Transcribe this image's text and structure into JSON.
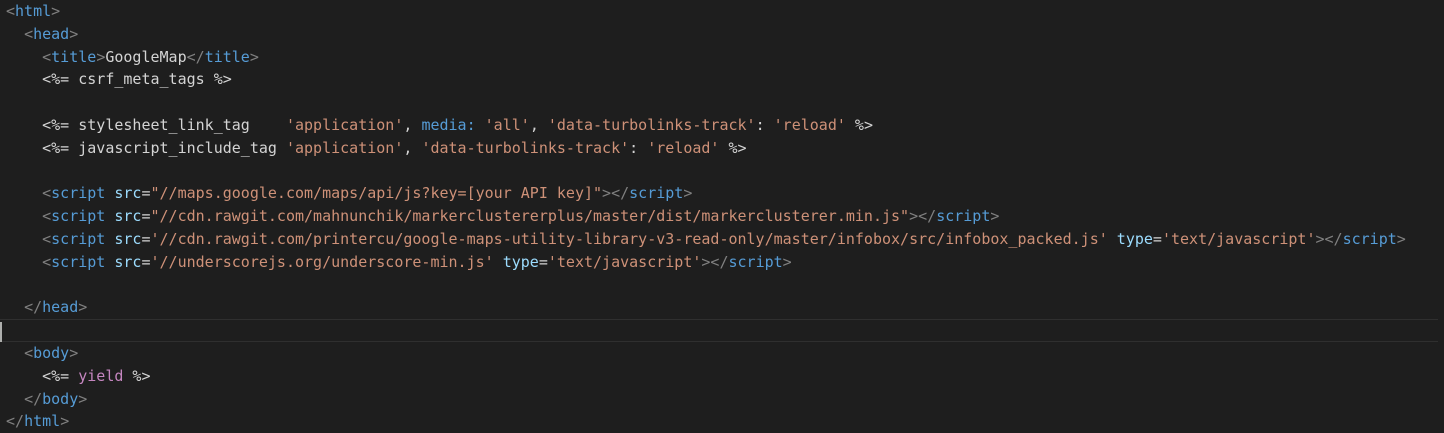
{
  "editor": {
    "lines": [
      {
        "indent": "",
        "tokens": [
          {
            "t": "<",
            "c": "c-punct"
          },
          {
            "t": "html",
            "c": "c-tag"
          },
          {
            "t": ">",
            "c": "c-punct"
          }
        ]
      },
      {
        "indent": "  ",
        "tokens": [
          {
            "t": "<",
            "c": "c-punct"
          },
          {
            "t": "head",
            "c": "c-tag"
          },
          {
            "t": ">",
            "c": "c-punct"
          }
        ]
      },
      {
        "indent": "    ",
        "tokens": [
          {
            "t": "<",
            "c": "c-punct"
          },
          {
            "t": "title",
            "c": "c-tag"
          },
          {
            "t": ">",
            "c": "c-punct"
          },
          {
            "t": "GoogleMap",
            "c": "c-text"
          },
          {
            "t": "</",
            "c": "c-punct"
          },
          {
            "t": "title",
            "c": "c-tag"
          },
          {
            "t": ">",
            "c": "c-punct"
          }
        ]
      },
      {
        "indent": "    ",
        "tokens": [
          {
            "t": "<%= csrf_meta_tags %>",
            "c": "c-erb"
          }
        ]
      },
      {
        "indent": "",
        "tokens": []
      },
      {
        "indent": "    ",
        "tokens": [
          {
            "t": "<%= stylesheet_link_tag    ",
            "c": "c-erb"
          },
          {
            "t": "'application'",
            "c": "c-str"
          },
          {
            "t": ", ",
            "c": "c-erb"
          },
          {
            "t": "media:",
            "c": "c-tag"
          },
          {
            "t": " ",
            "c": "c-erb"
          },
          {
            "t": "'all'",
            "c": "c-str"
          },
          {
            "t": ", ",
            "c": "c-erb"
          },
          {
            "t": "'data-turbolinks-track'",
            "c": "c-str"
          },
          {
            "t": ": ",
            "c": "c-erb"
          },
          {
            "t": "'reload'",
            "c": "c-str"
          },
          {
            "t": " %>",
            "c": "c-erb"
          }
        ]
      },
      {
        "indent": "    ",
        "tokens": [
          {
            "t": "<%= javascript_include_tag ",
            "c": "c-erb"
          },
          {
            "t": "'application'",
            "c": "c-str"
          },
          {
            "t": ", ",
            "c": "c-erb"
          },
          {
            "t": "'data-turbolinks-track'",
            "c": "c-str"
          },
          {
            "t": ": ",
            "c": "c-erb"
          },
          {
            "t": "'reload'",
            "c": "c-str"
          },
          {
            "t": " %>",
            "c": "c-erb"
          }
        ]
      },
      {
        "indent": "",
        "tokens": []
      },
      {
        "indent": "    ",
        "tokens": [
          {
            "t": "<",
            "c": "c-punct"
          },
          {
            "t": "script",
            "c": "c-tag"
          },
          {
            "t": " ",
            "c": "c-text"
          },
          {
            "t": "src",
            "c": "c-attr"
          },
          {
            "t": "=",
            "c": "c-text"
          },
          {
            "t": "\"//maps.google.com/maps/api/js?key=[your API key]\"",
            "c": "c-str"
          },
          {
            "t": "></",
            "c": "c-punct"
          },
          {
            "t": "script",
            "c": "c-tag"
          },
          {
            "t": ">",
            "c": "c-punct"
          }
        ]
      },
      {
        "indent": "    ",
        "tokens": [
          {
            "t": "<",
            "c": "c-punct"
          },
          {
            "t": "script",
            "c": "c-tag"
          },
          {
            "t": " ",
            "c": "c-text"
          },
          {
            "t": "src",
            "c": "c-attr"
          },
          {
            "t": "=",
            "c": "c-text"
          },
          {
            "t": "\"//cdn.rawgit.com/mahnunchik/markerclustererplus/master/dist/markerclusterer.min.js\"",
            "c": "c-str"
          },
          {
            "t": "></",
            "c": "c-punct"
          },
          {
            "t": "script",
            "c": "c-tag"
          },
          {
            "t": ">",
            "c": "c-punct"
          }
        ]
      },
      {
        "indent": "    ",
        "tokens": [
          {
            "t": "<",
            "c": "c-punct"
          },
          {
            "t": "script",
            "c": "c-tag"
          },
          {
            "t": " ",
            "c": "c-text"
          },
          {
            "t": "src",
            "c": "c-attr"
          },
          {
            "t": "=",
            "c": "c-text"
          },
          {
            "t": "'//cdn.rawgit.com/printercu/google-maps-utility-library-v3-read-only/master/infobox/src/infobox_packed.js'",
            "c": "c-str"
          },
          {
            "t": " ",
            "c": "c-text"
          },
          {
            "t": "type",
            "c": "c-attr"
          },
          {
            "t": "=",
            "c": "c-text"
          },
          {
            "t": "'text/javascript'",
            "c": "c-str"
          },
          {
            "t": "></",
            "c": "c-punct"
          },
          {
            "t": "script",
            "c": "c-tag"
          },
          {
            "t": ">",
            "c": "c-punct"
          }
        ]
      },
      {
        "indent": "    ",
        "tokens": [
          {
            "t": "<",
            "c": "c-punct"
          },
          {
            "t": "script",
            "c": "c-tag"
          },
          {
            "t": " ",
            "c": "c-text"
          },
          {
            "t": "src",
            "c": "c-attr"
          },
          {
            "t": "=",
            "c": "c-text"
          },
          {
            "t": "'//underscorejs.org/underscore-min.js'",
            "c": "c-str"
          },
          {
            "t": " ",
            "c": "c-text"
          },
          {
            "t": "type",
            "c": "c-attr"
          },
          {
            "t": "=",
            "c": "c-text"
          },
          {
            "t": "'text/javascript'",
            "c": "c-str"
          },
          {
            "t": "></",
            "c": "c-punct"
          },
          {
            "t": "script",
            "c": "c-tag"
          },
          {
            "t": ">",
            "c": "c-punct"
          }
        ]
      },
      {
        "indent": "",
        "tokens": []
      },
      {
        "indent": "  ",
        "tokens": [
          {
            "t": "</",
            "c": "c-punct"
          },
          {
            "t": "head",
            "c": "c-tag"
          },
          {
            "t": ">",
            "c": "c-punct"
          }
        ]
      },
      {
        "indent": "",
        "tokens": [],
        "current": true
      },
      {
        "indent": "  ",
        "tokens": [
          {
            "t": "<",
            "c": "c-punct"
          },
          {
            "t": "body",
            "c": "c-tag"
          },
          {
            "t": ">",
            "c": "c-punct"
          }
        ]
      },
      {
        "indent": "    ",
        "tokens": [
          {
            "t": "<%= ",
            "c": "c-erb"
          },
          {
            "t": "yield",
            "c": "c-kw"
          },
          {
            "t": " %>",
            "c": "c-erb"
          }
        ]
      },
      {
        "indent": "  ",
        "tokens": [
          {
            "t": "</",
            "c": "c-punct"
          },
          {
            "t": "body",
            "c": "c-tag"
          },
          {
            "t": ">",
            "c": "c-punct"
          }
        ]
      },
      {
        "indent": "",
        "tokens": [
          {
            "t": "</",
            "c": "c-punct"
          },
          {
            "t": "html",
            "c": "c-tag"
          },
          {
            "t": ">",
            "c": "c-punct"
          }
        ]
      }
    ]
  }
}
